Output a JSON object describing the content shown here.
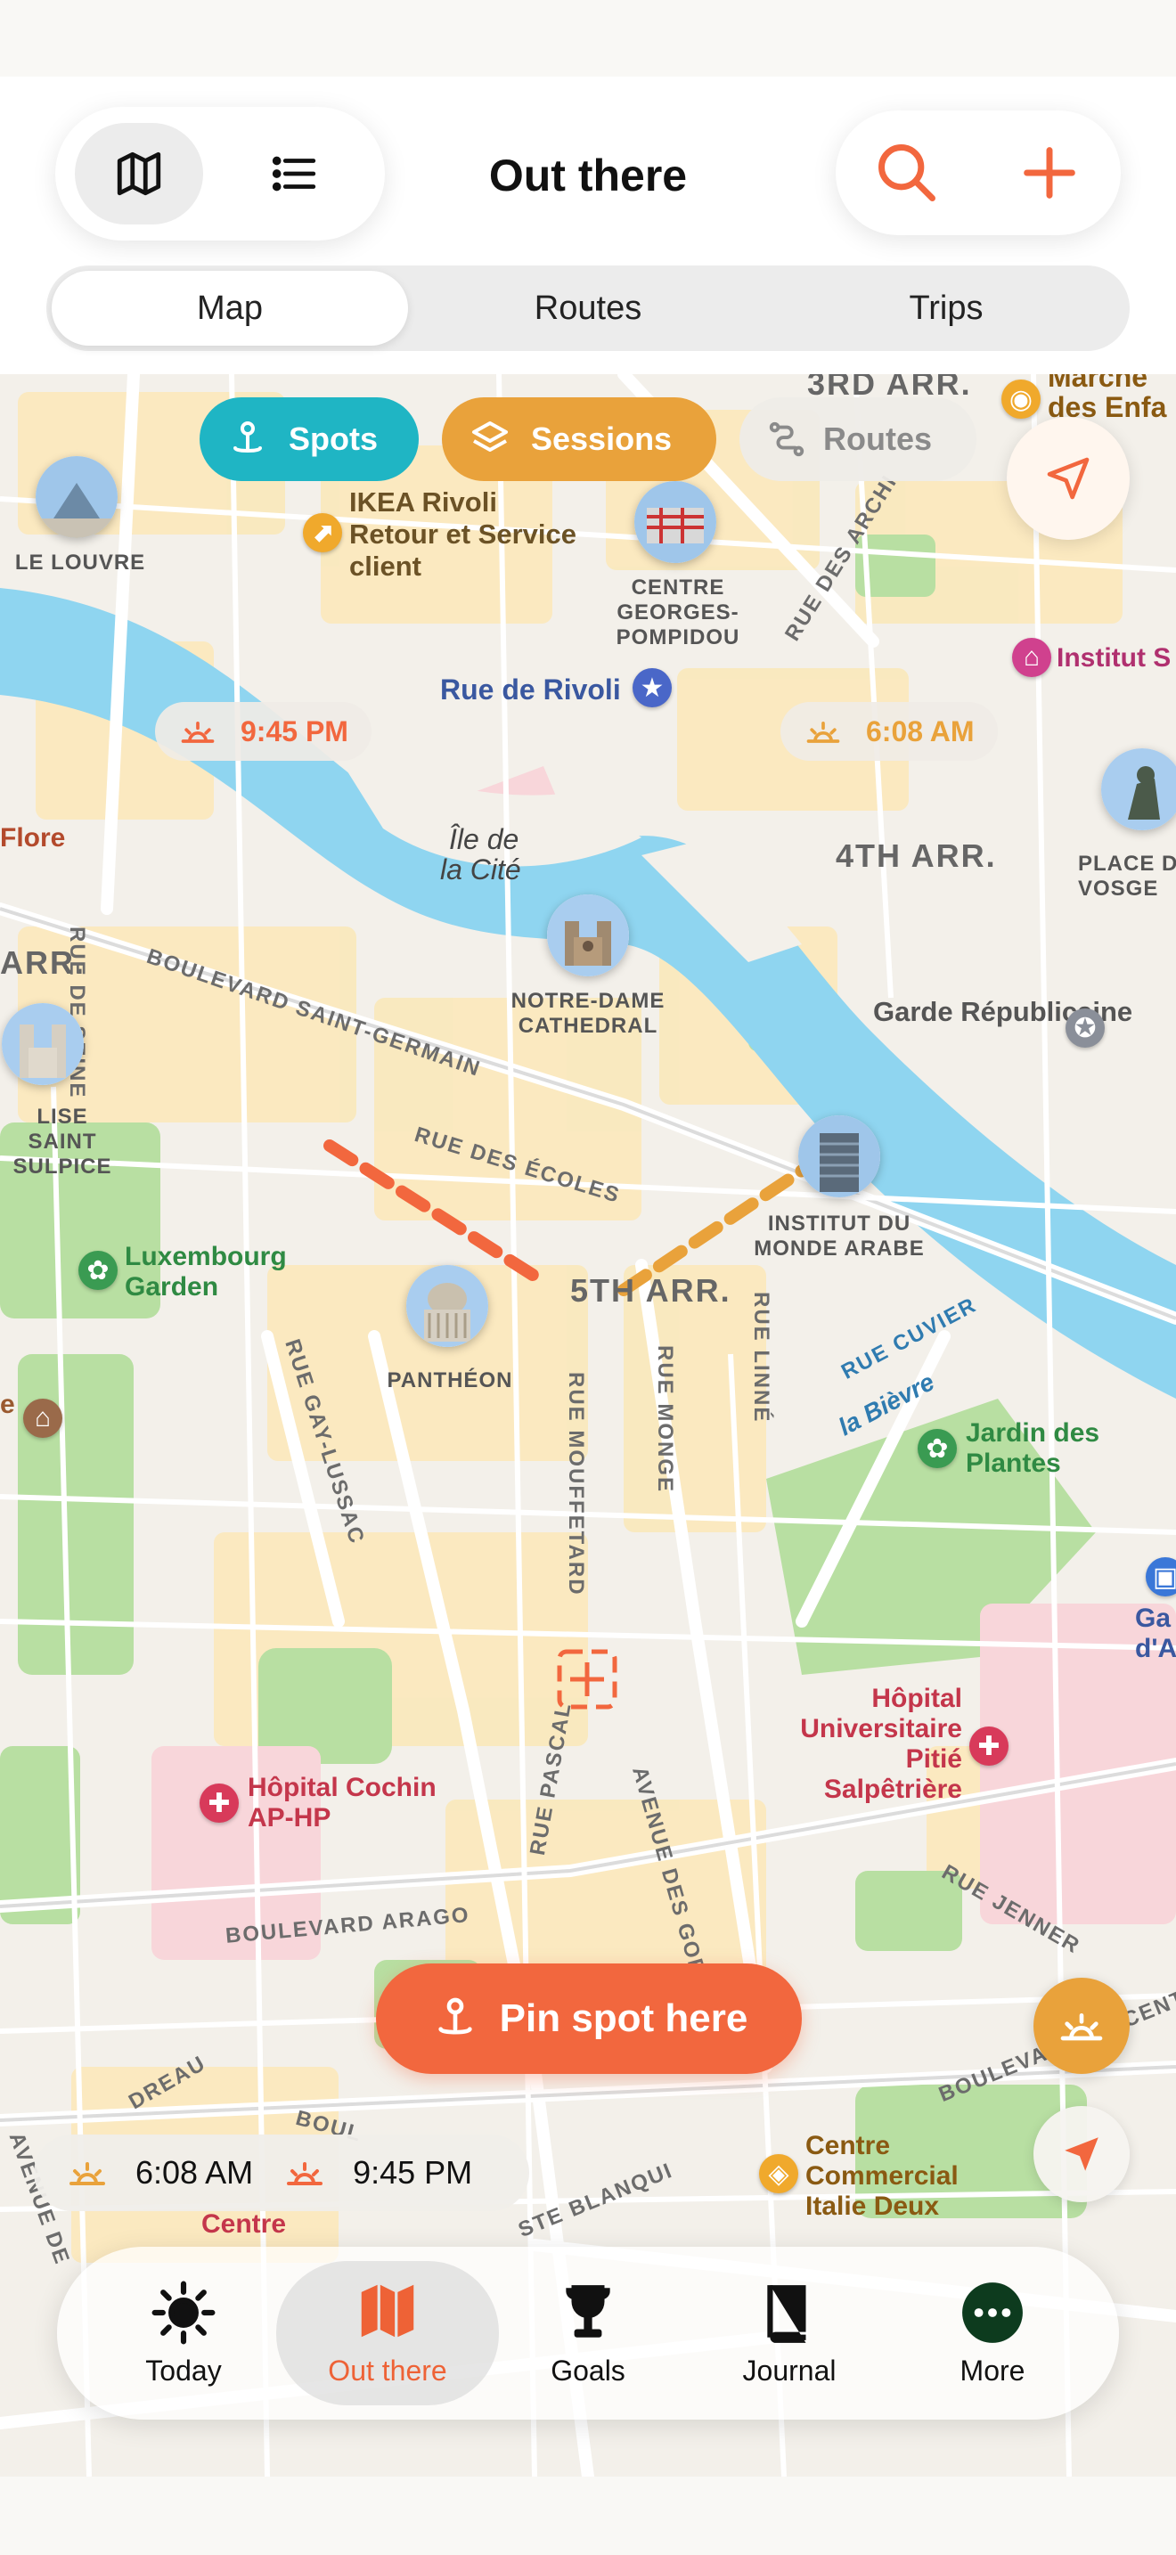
{
  "header": {
    "title": "Out there",
    "view_toggle": [
      {
        "name": "map-view",
        "icon": "map-icon",
        "active": true
      },
      {
        "name": "list-view",
        "icon": "list-icon",
        "active": false
      }
    ],
    "actions": [
      {
        "icon": "search-icon"
      },
      {
        "icon": "plus-icon"
      }
    ],
    "tabs": [
      {
        "label": "Map",
        "active": true
      },
      {
        "label": "Routes",
        "active": false
      },
      {
        "label": "Trips",
        "active": false
      }
    ]
  },
  "filters": {
    "spots": "Spots",
    "sessions": "Sessions",
    "routes": "Routes"
  },
  "map": {
    "districts": {
      "a3": "3RD ARR.",
      "a4": "4TH ARR.",
      "a5": "5TH ARR.",
      "a6": "ARR."
    },
    "islands": {
      "cite_line1": "Île de",
      "cite_line2": "la Cité"
    },
    "streets": {
      "seine": "RUE DE SEINE",
      "st_germain": "BOULEVARD SAINT-GERMAIN",
      "ecoles": "RUE DES ÉCOLES",
      "gay_lussac": "RUE GAY-LUSSAC",
      "mouffetard": "RUE MOUFFETARD",
      "monge": "RUE MONGE",
      "linne": "RUE LINNÉ",
      "cuvier": "RUE CUVIER",
      "archives": "RUE DES ARCHI",
      "arago": "BOULEVARD ARAGO",
      "pascal": "RUE PASCAL",
      "gobelins": "AVENUE DES GOB",
      "jenner": "RUE JENNER",
      "blanqui": "STE BLANQUI",
      "boul_vincent": "BOULEVARD VINCENT",
      "reau": "DREAU",
      "boul": "BOUL",
      "avenue": "AVENUE DE",
      "bievre": "la Bièvre"
    },
    "landmarks": {
      "louvre": "LE LOUVRE",
      "pompidou": "CENTRE GEORGES-POMPIDOU",
      "notre_dame": "NOTRE-DAME CATHEDRAL",
      "st_sulpice": "LISE SAINT SULPICE",
      "institut": "INSTITUT DU MONDE ARABE",
      "pantheon": "PANTHÉON",
      "vosges": "PLACE DE VOSGE"
    },
    "pois": {
      "ikea": "IKEA Rivoli Retour et Service client",
      "rivoli": "Rue de Rivoli",
      "marche": "Marché des Enfa ges",
      "institut_s": "Institut S",
      "flore": "Flore",
      "garde": "Garde Républicaine",
      "luxembourg": "Luxembourg Garden",
      "jardin": "Jardin des Plantes",
      "pitie": "Hôpital Universitaire Pitié Salpêtrière",
      "cochin": "Hôpital Cochin AP-HP",
      "gare": "Ga d'Aus",
      "italie": "Centre Commercial Italie Deux",
      "centre_obs": "Centre",
      "e_frag": "e"
    },
    "sunset_chip": "9:45 PM",
    "sunrise_chip": "6:08 AM"
  },
  "pin_button": "Pin spot here",
  "sun_times": {
    "sunrise": "6:08 AM",
    "sunset": "9:45 PM"
  },
  "tabbar": [
    {
      "label": "Today",
      "icon": "sun-icon",
      "active": false
    },
    {
      "label": "Out there",
      "icon": "map-icon",
      "active": true
    },
    {
      "label": "Goals",
      "icon": "trophy-icon",
      "active": false
    },
    {
      "label": "Journal",
      "icon": "book-icon",
      "active": false
    },
    {
      "label": "More",
      "icon": "more-icon",
      "active": false
    }
  ],
  "colors": {
    "accent": "#F2673E",
    "spots": "#1FB5C4",
    "sessions": "#E9A23B",
    "water": "#8FD5F0",
    "park": "#B6DFA0",
    "sunset": "#F2673E",
    "sunrise": "#E9A23B"
  }
}
